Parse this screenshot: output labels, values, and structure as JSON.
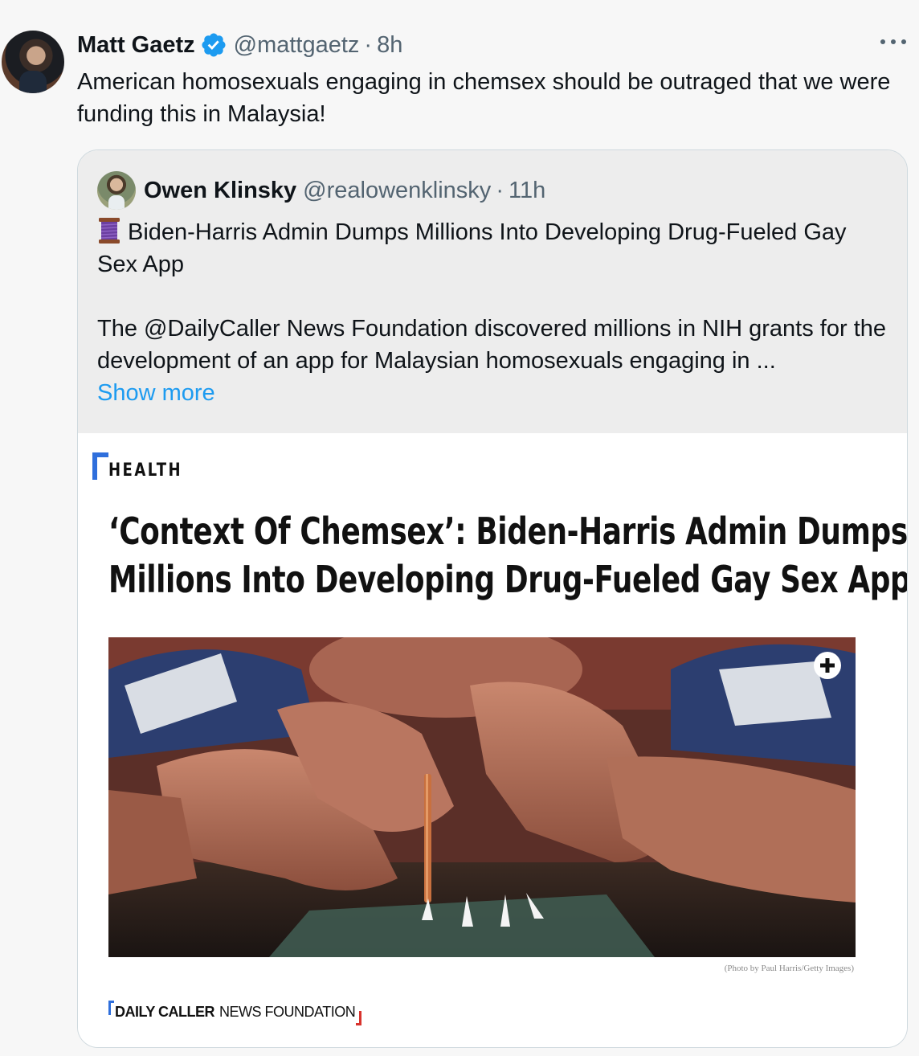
{
  "tweet": {
    "author": {
      "name": "Matt Gaetz",
      "handle": "@mattgaetz",
      "separator": "·",
      "time": "8h",
      "verified_icon": "verified-badge-icon"
    },
    "text": "American homosexuals engaging in chemsex should be outraged that we were funding this in Malaysia!",
    "more_icon": "more-horizontal-icon"
  },
  "quote": {
    "author": {
      "name": "Owen Klinsky",
      "handle": "@realowenklinsky",
      "separator": "·",
      "time": "11h"
    },
    "title_icon": "thread-spool-icon",
    "title": "Biden-Harris Admin Dumps Millions Into Developing Drug-Fueled Gay Sex App",
    "body": "The @DailyCaller News Foundation discovered millions in NIH grants for the development of an app for Malaysian homosexuals engaging in ...",
    "show_more": "Show more"
  },
  "article": {
    "section": "HEALTH",
    "headline_line1": "‘Context Of Chemsex’: Biden-Harris Admin Dumps",
    "headline_line2": "Millions Into Developing Drug-Fueled Gay Sex App",
    "photo_credit": "(Photo by Paul Harris/Getty Images)",
    "expand_icon": "plus-circle-icon",
    "brand_bold": "DAILY CALLER",
    "brand_light": "NEWS FOUNDATION",
    "colors": {
      "brand_blue": "#2f6fdc",
      "brand_red": "#d8332d",
      "link_blue": "#1d9bf0"
    }
  }
}
